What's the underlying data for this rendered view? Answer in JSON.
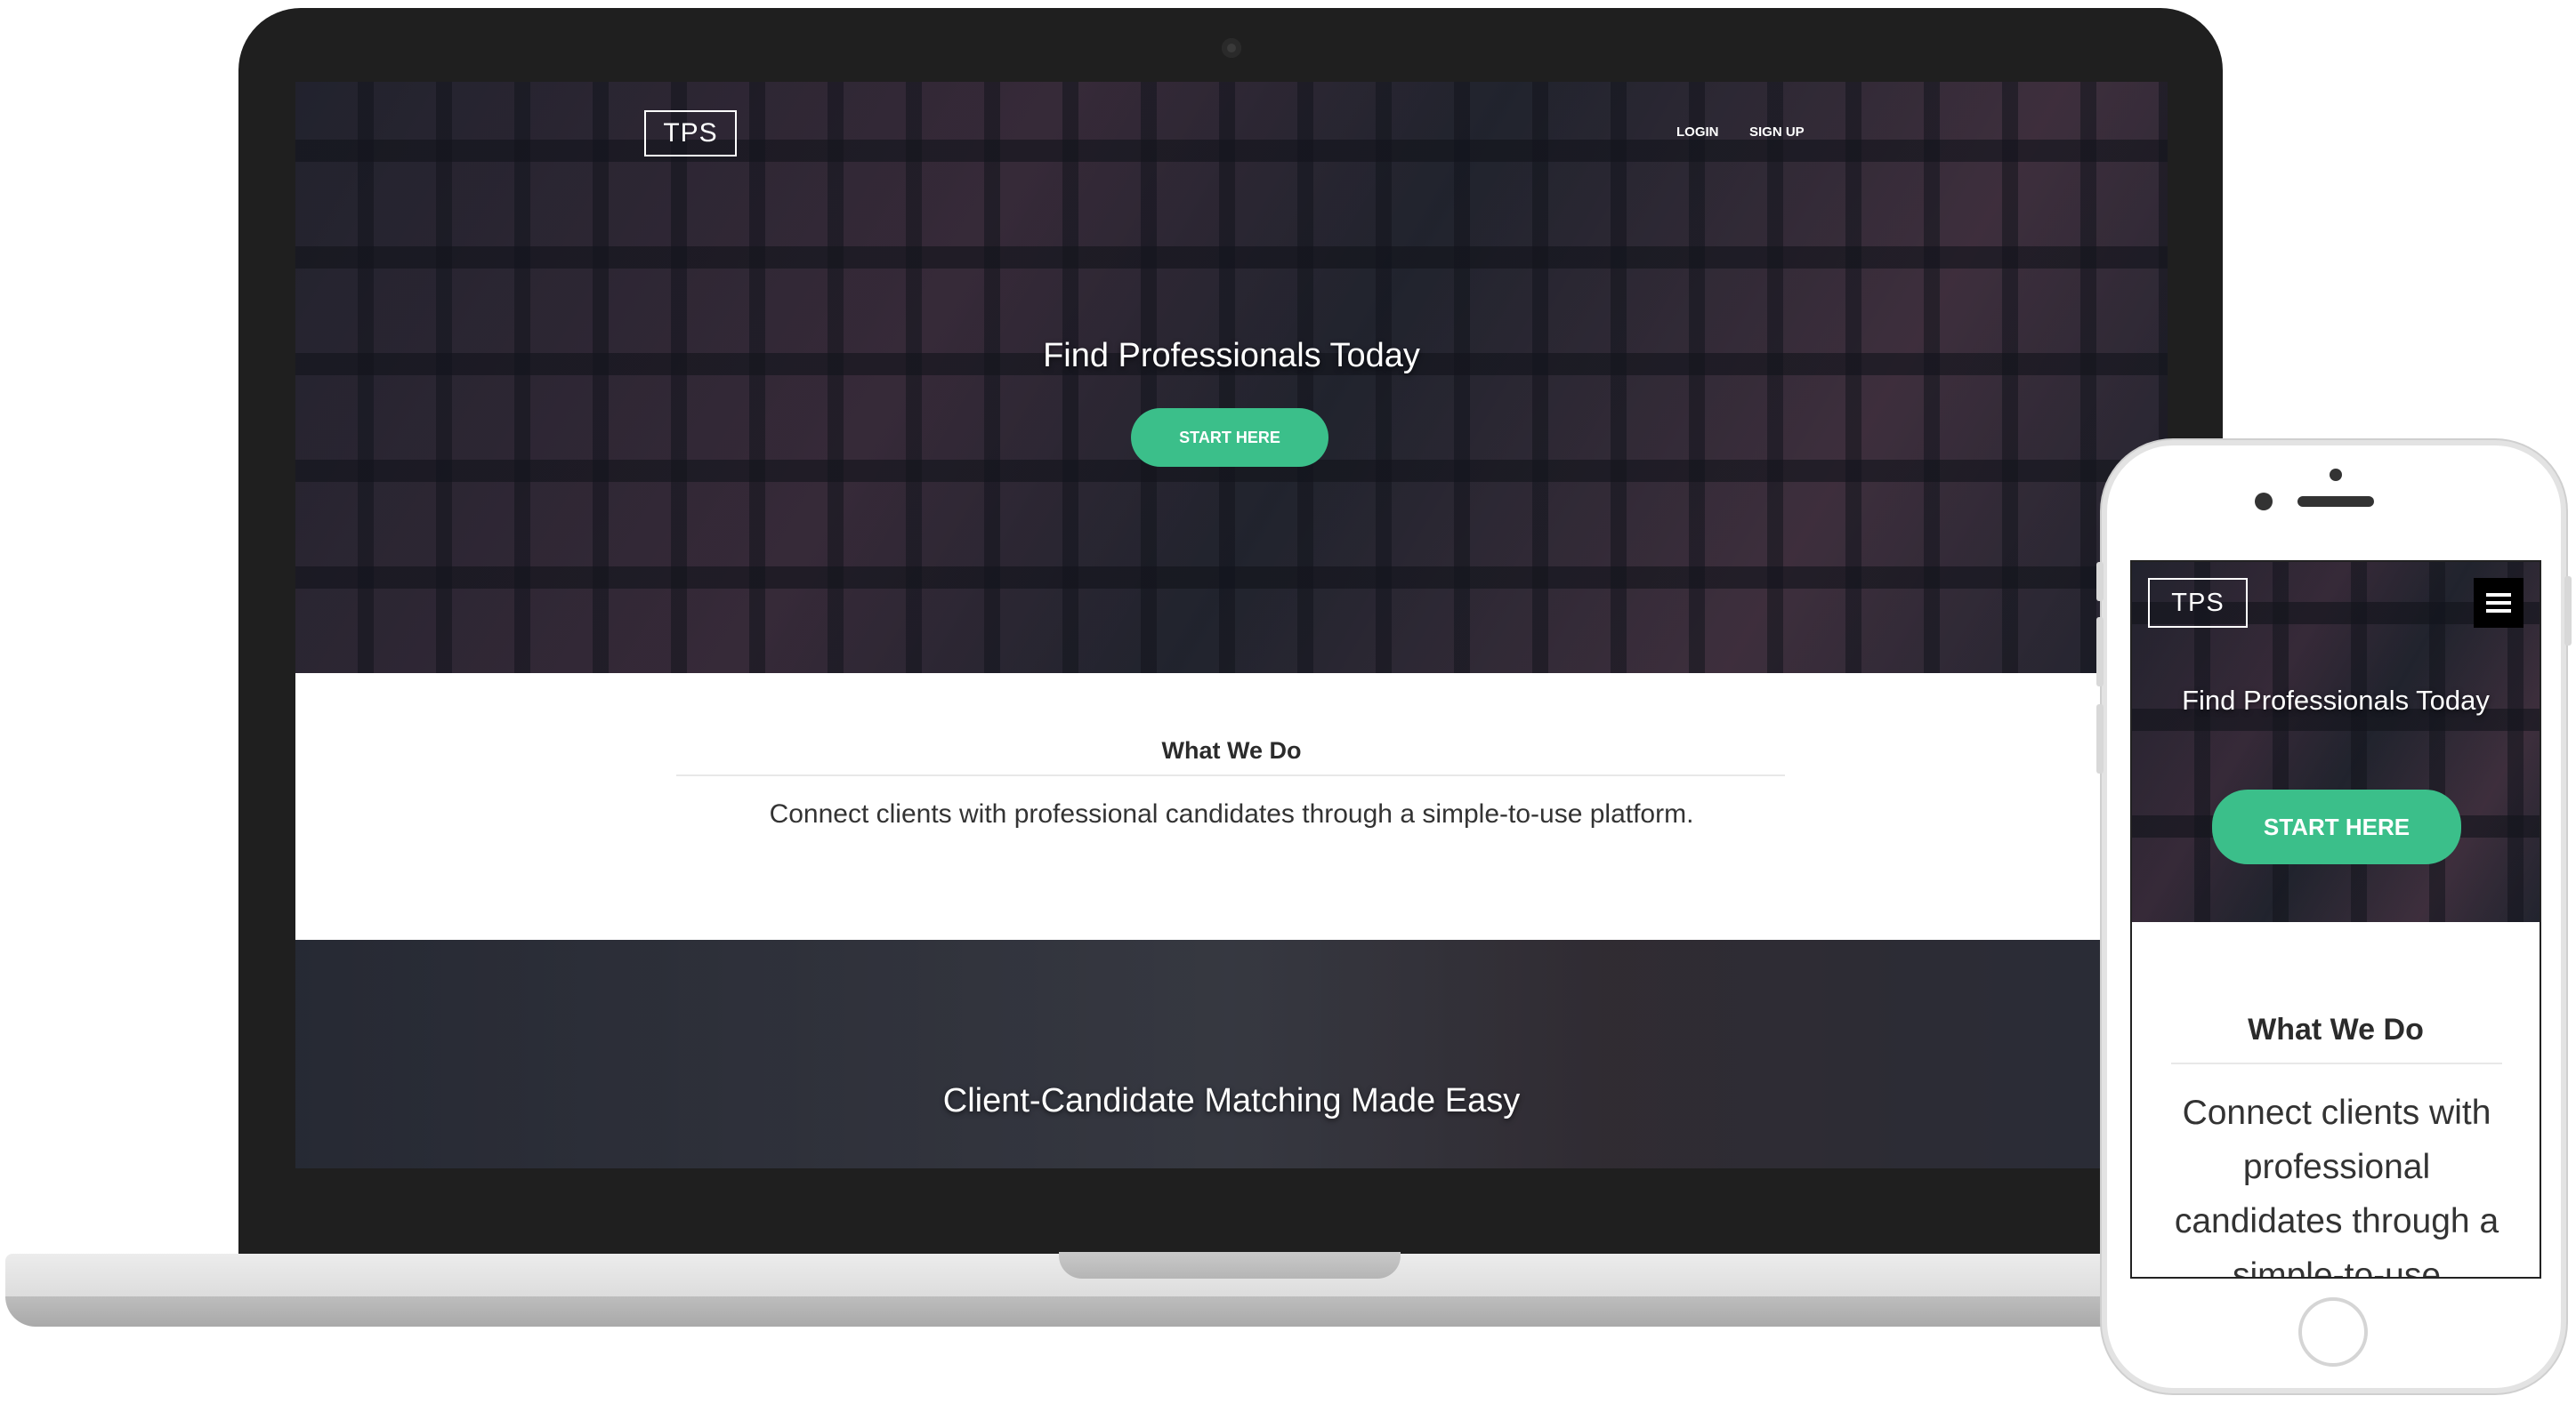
{
  "site": {
    "logo": "TPS",
    "nav": {
      "login": "LOGIN",
      "signup": "SIGN UP"
    },
    "hero": {
      "title": "Find Professionals Today",
      "cta": "START HERE"
    },
    "about": {
      "heading": "What We Do",
      "text": "Connect clients with professional candidates through a simple-to-use platform."
    },
    "feature": {
      "title": "Client-Candidate Matching Made Easy"
    }
  },
  "mobile": {
    "logo": "TPS",
    "hero": {
      "title": "Find Professionals Today",
      "cta": "START HERE"
    },
    "about": {
      "heading": "What We Do",
      "text": "Connect clients with professional candidates through a simple-to-use platform."
    },
    "menu_icon": "hamburger-icon"
  },
  "colors": {
    "accent": "#3bbf8a",
    "frame": "#1f1f1f",
    "text": "#333333"
  }
}
